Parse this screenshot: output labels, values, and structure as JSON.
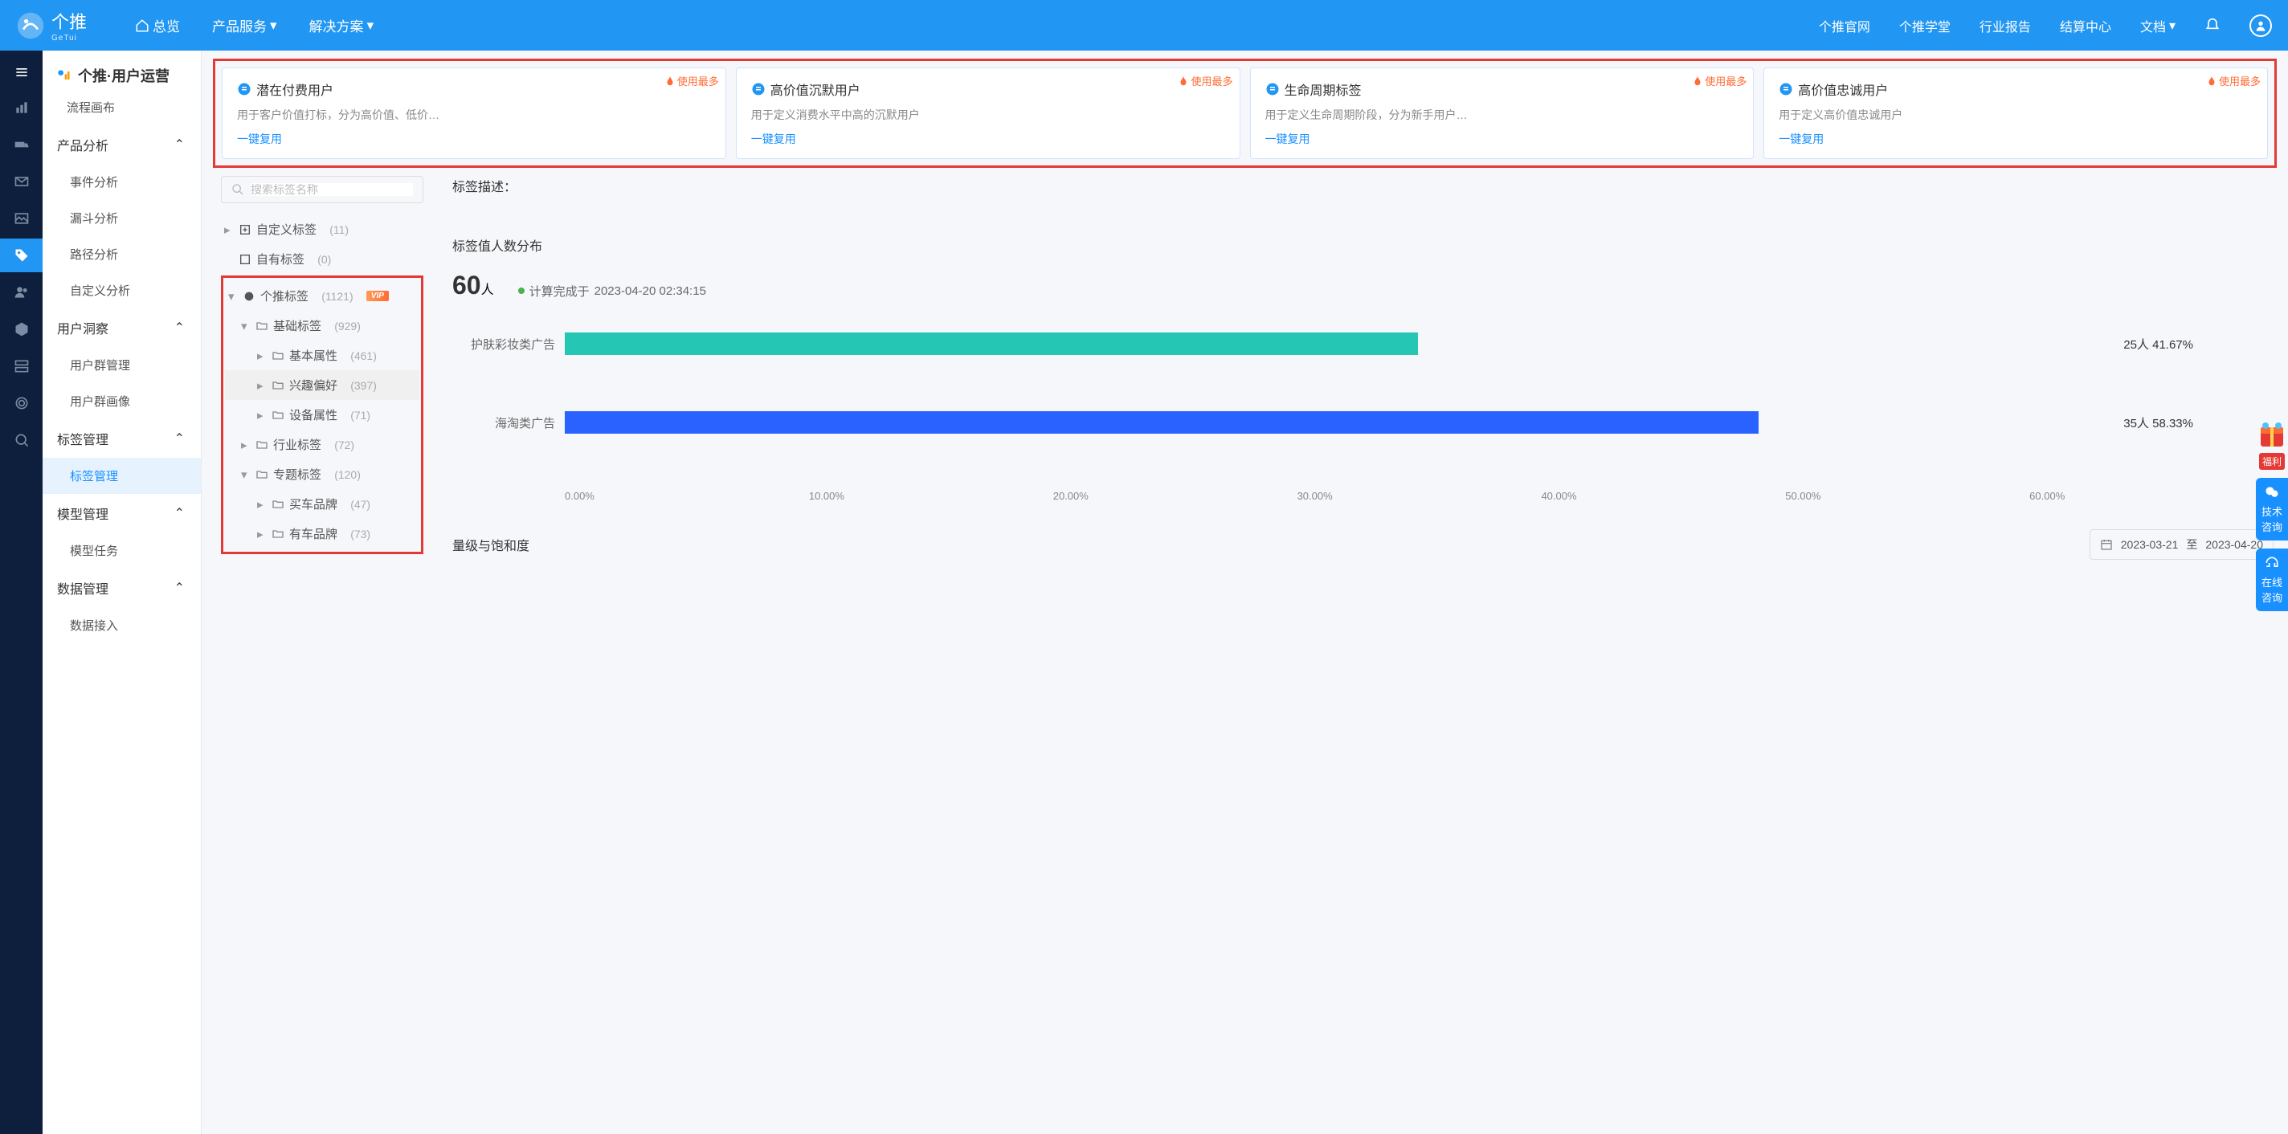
{
  "header": {
    "logo_text": "个推",
    "logo_sub": "GeTui",
    "nav": {
      "overview": "总览",
      "products": "产品服务",
      "solutions": "解决方案"
    },
    "right": {
      "official": "个推官网",
      "school": "个推学堂",
      "report": "行业报告",
      "settlement": "结算中心",
      "docs": "文档"
    }
  },
  "sidebar": {
    "title": "个推·用户运营",
    "flow_cut": "流程画布",
    "groups": {
      "product": {
        "label": "产品分析",
        "items": [
          "事件分析",
          "漏斗分析",
          "路径分析",
          "自定义分析"
        ]
      },
      "insight": {
        "label": "用户洞察",
        "items": [
          "用户群管理",
          "用户群画像"
        ]
      },
      "tag": {
        "label": "标签管理",
        "items": [
          "标签管理"
        ]
      },
      "model": {
        "label": "模型管理",
        "items": [
          "模型任务"
        ]
      },
      "data": {
        "label": "数据管理",
        "items": [
          "数据接入"
        ]
      }
    }
  },
  "hot_cards": {
    "badge": "使用最多",
    "link": "一键复用",
    "cards": [
      {
        "title": "潜在付费用户",
        "desc": "用于客户价值打标，分为高价值、低价…"
      },
      {
        "title": "高价值沉默用户",
        "desc": "用于定义消费水平中高的沉默用户"
      },
      {
        "title": "生命周期标签",
        "desc": "用于定义生命周期阶段，分为新手用户…"
      },
      {
        "title": "高价值忠诚用户",
        "desc": "用于定义高价值忠诚用户"
      }
    ]
  },
  "tree": {
    "search_placeholder": "搜索标签名称",
    "custom": {
      "label": "自定义标签",
      "count": "(11)"
    },
    "own": {
      "label": "自有标签",
      "count": "(0)"
    },
    "getui": {
      "label": "个推标签",
      "count": "(1121)"
    },
    "basic": {
      "label": "基础标签",
      "count": "(929)"
    },
    "basic_attr": {
      "label": "基本属性",
      "count": "(461)"
    },
    "interest": {
      "label": "兴趣偏好",
      "count": "(397)"
    },
    "device": {
      "label": "设备属性",
      "count": "(71)"
    },
    "industry": {
      "label": "行业标签",
      "count": "(72)"
    },
    "topic": {
      "label": "专题标签",
      "count": "(120)"
    },
    "buy_car": {
      "label": "买车品牌",
      "count": "(47)"
    },
    "own_car": {
      "label": "有车品牌",
      "count": "(73)"
    }
  },
  "chart": {
    "desc_label": "标签描述：",
    "dist_label": "标签值人数分布",
    "total": "60",
    "total_unit": "人",
    "compute_prefix": "计算完成于",
    "compute_time": "2023-04-20 02:34:15",
    "sat_label": "量级与饱和度",
    "date_from": "2023-03-21",
    "date_sep": "至",
    "date_to": "2023-04-20",
    "xticks": [
      "0.00%",
      "10.00%",
      "20.00%",
      "30.00%",
      "40.00%",
      "50.00%",
      "60.00%"
    ]
  },
  "chart_data": {
    "type": "bar",
    "orientation": "horizontal",
    "categories": [
      "护肤彩妆类广告",
      "海淘类广告"
    ],
    "series": [
      {
        "name": "count",
        "values": [
          25,
          35
        ]
      },
      {
        "name": "percent",
        "values": [
          41.67,
          58.33
        ]
      }
    ],
    "colors": [
      "#26c6b4",
      "#2962ff"
    ],
    "value_labels": [
      "25人 41.67%",
      "35人 58.33%"
    ],
    "xlabel": "",
    "ylabel": "",
    "xlim": [
      0,
      60
    ]
  },
  "float": {
    "tech": "技术咨询",
    "online": "在线咨询",
    "welfare": "福利"
  }
}
